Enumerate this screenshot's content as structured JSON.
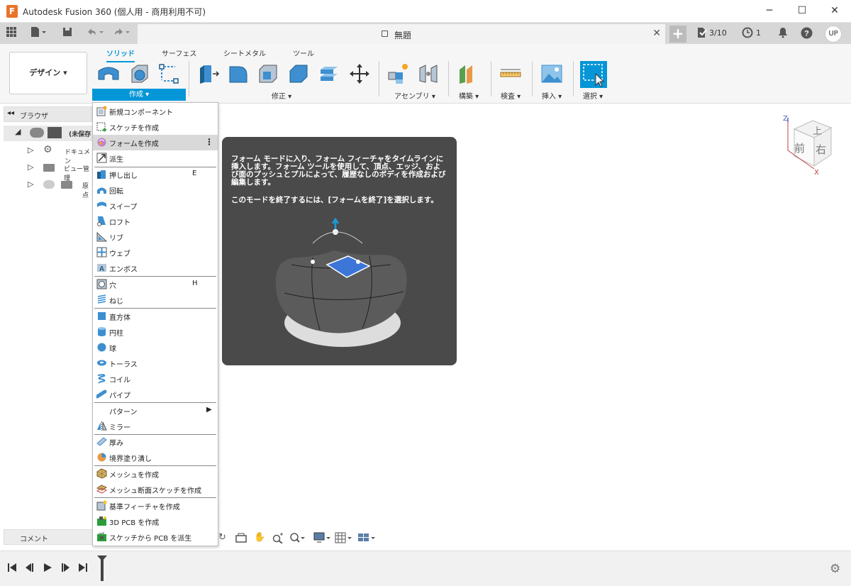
{
  "window": {
    "title": "Autodesk Fusion 360 (個人用 - 商用利用不可)",
    "logo": "F",
    "minimize": "─",
    "maximize": "☐",
    "close": "✕"
  },
  "tabbar": {
    "doc_title": "無題",
    "doc_close": "✕",
    "plus": "+",
    "jobs": "3/10",
    "history": "1",
    "user": "UP"
  },
  "toolbar": {
    "workspace": "デザイン ▾",
    "tabs": [
      "ソリッド",
      "サーフェス",
      "シートメタル",
      "ツール"
    ],
    "groups": [
      "作成 ▾",
      "修正 ▾",
      "アセンブリ ▾",
      "構築 ▾",
      "検査 ▾",
      "挿入 ▾",
      "選択 ▾"
    ]
  },
  "browser": {
    "label": "ブラウザ",
    "collapse": "◂◂",
    "root": "(未保存",
    "items": [
      "ドキュメン",
      "ビュー管理",
      "原点"
    ]
  },
  "comment": {
    "label": "コメント"
  },
  "menu": {
    "items": [
      {
        "label": "新規コンポーネント"
      },
      {
        "label": "スケッチを作成"
      },
      {
        "label": "フォームを作成",
        "more": "⋮"
      },
      {
        "label": "派生"
      },
      {
        "label": "押し出し",
        "shortcut": "E"
      },
      {
        "label": "回転"
      },
      {
        "label": "スイープ"
      },
      {
        "label": "ロフト"
      },
      {
        "label": "リブ"
      },
      {
        "label": "ウェブ"
      },
      {
        "label": "エンボス"
      },
      {
        "label": "穴",
        "shortcut": "H"
      },
      {
        "label": "ねじ"
      },
      {
        "label": "直方体"
      },
      {
        "label": "円柱"
      },
      {
        "label": "球"
      },
      {
        "label": "トーラス"
      },
      {
        "label": "コイル"
      },
      {
        "label": "パイプ"
      },
      {
        "label": "パターン",
        "arrow": "▶"
      },
      {
        "label": "ミラー"
      },
      {
        "label": "厚み"
      },
      {
        "label": "境界塗り潰し"
      },
      {
        "label": "メッシュを作成"
      },
      {
        "label": "メッシュ断面スケッチを作成"
      },
      {
        "label": "基準フィーチャを作成"
      },
      {
        "label": "3D PCB を作成"
      },
      {
        "label": "スケッチから PCB を派生"
      }
    ]
  },
  "tooltip": {
    "line1": "フォーム モードに入り、フォーム フィーチャをタイムラインに挿入します。フォーム ツールを使用して、頂点、エッジ、および面のプッシュとプルによって、履歴なしのボディを作成および編集します。",
    "line2": "このモードを終了するには、[フォームを終了]を選択します。"
  },
  "viewcube": {
    "top": "上",
    "front": "前",
    "right": "右",
    "axis_z": "Z",
    "axis_x": "X"
  },
  "timeline": {
    "first": "⏮",
    "prev": "◀",
    "play": "▶",
    "next": "▶",
    "last": "⏭"
  },
  "colors": {
    "accent": "#0696d7",
    "tooltip_bg": "#4a4a4a"
  }
}
